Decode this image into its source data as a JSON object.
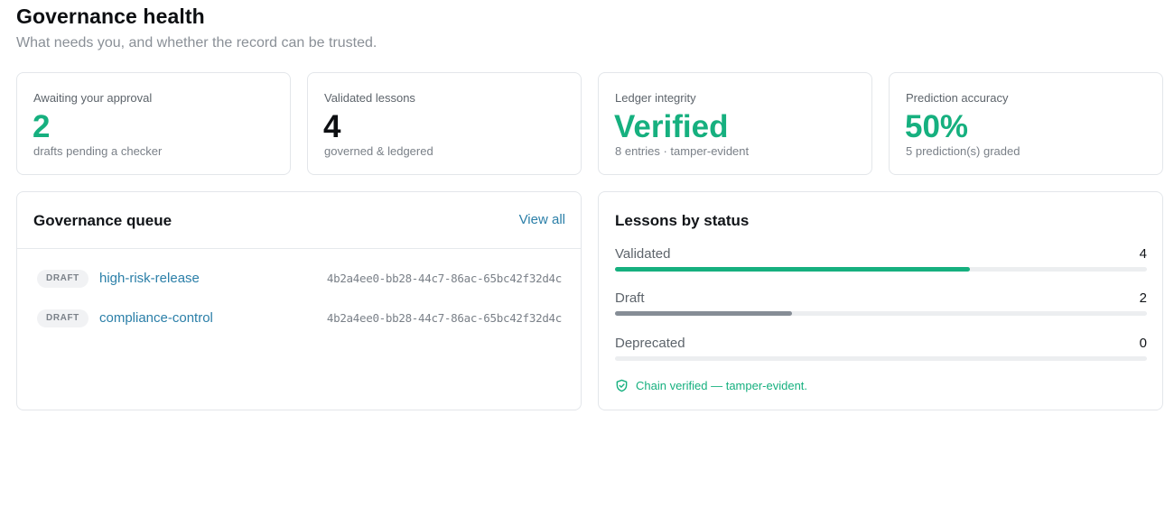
{
  "header": {
    "title": "Governance health",
    "subtitle": "What needs you, and whether the record can be trusted."
  },
  "stats": [
    {
      "label": "Awaiting your approval",
      "value": "2",
      "sub": "drafts pending a checker",
      "color": "#16b07f"
    },
    {
      "label": "Validated lessons",
      "value": "4",
      "sub": "governed & ledgered",
      "color": "#0d0f12"
    },
    {
      "label": "Ledger integrity",
      "value": "Verified",
      "sub": "8 entries · tamper-evident",
      "color": "#16b07f"
    },
    {
      "label": "Prediction accuracy",
      "value": "50%",
      "sub": "5 prediction(s) graded",
      "color": "#16b07f"
    }
  ],
  "queue": {
    "title": "Governance queue",
    "view_all": "View all",
    "items": [
      {
        "badge": "DRAFT",
        "name": "high-risk-release",
        "id": "4b2a4ee0-bb28-44c7-86ac-65bc42f32d4c"
      },
      {
        "badge": "DRAFT",
        "name": "compliance-control",
        "id": "4b2a4ee0-bb28-44c7-86ac-65bc42f32d4c"
      }
    ]
  },
  "lessons": {
    "title": "Lessons by status",
    "statuses": [
      {
        "label": "Validated",
        "count": "4",
        "fraction": 0.6667,
        "color": "#16b07f"
      },
      {
        "label": "Draft",
        "count": "2",
        "fraction": 0.3333,
        "color": "#868d96"
      },
      {
        "label": "Deprecated",
        "count": "0",
        "fraction": 0,
        "color": "#868d96"
      }
    ],
    "chain_note": "Chain verified — tamper-evident.",
    "chain_icon": "shield-check-icon"
  },
  "colors": {
    "accent": "#16b07f",
    "link": "#2b7fa8"
  }
}
